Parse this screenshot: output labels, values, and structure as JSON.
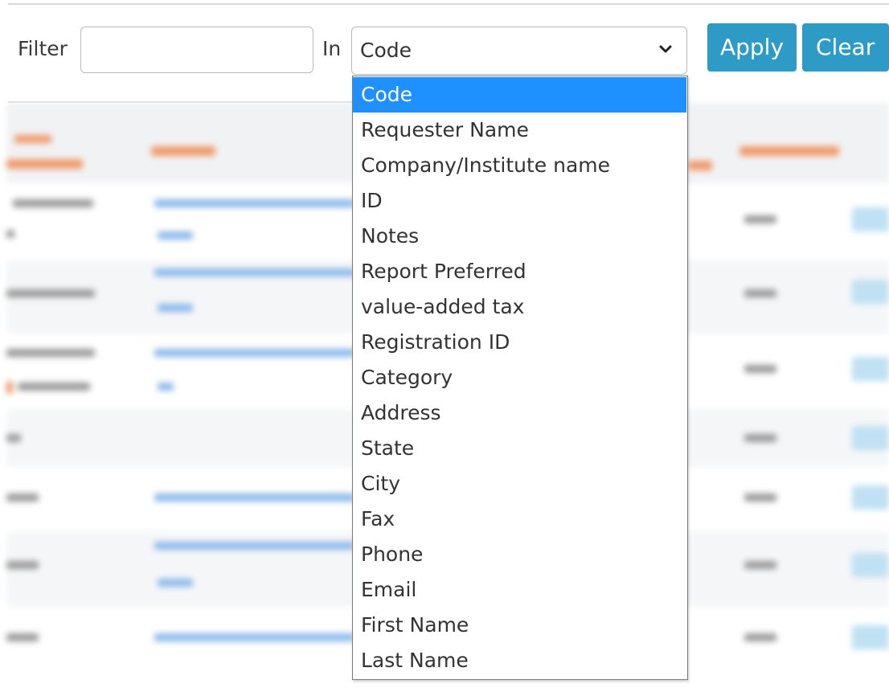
{
  "toolbar": {
    "filter_label": "Filter",
    "filter_value": "",
    "in_label": "In",
    "selected_field": "Code",
    "apply_label": "Apply",
    "clear_label": "Clear"
  },
  "dropdown": {
    "options": [
      "Code",
      "Requester Name",
      "Company/Institute name",
      "ID",
      "Notes",
      "Report Preferred",
      "value-added tax",
      "Registration ID",
      "Category",
      "Address",
      "State",
      "City",
      "Fax",
      "Phone",
      "Email",
      "First Name",
      "Last Name"
    ],
    "selected_index": 0
  },
  "colors": {
    "button": "#2e9bc7",
    "selected_option": "#1e90ff",
    "header_text": "#f09a6a",
    "link_text": "#8cb9ea"
  },
  "icons": {
    "select_arrow": "chevron-down-icon"
  }
}
